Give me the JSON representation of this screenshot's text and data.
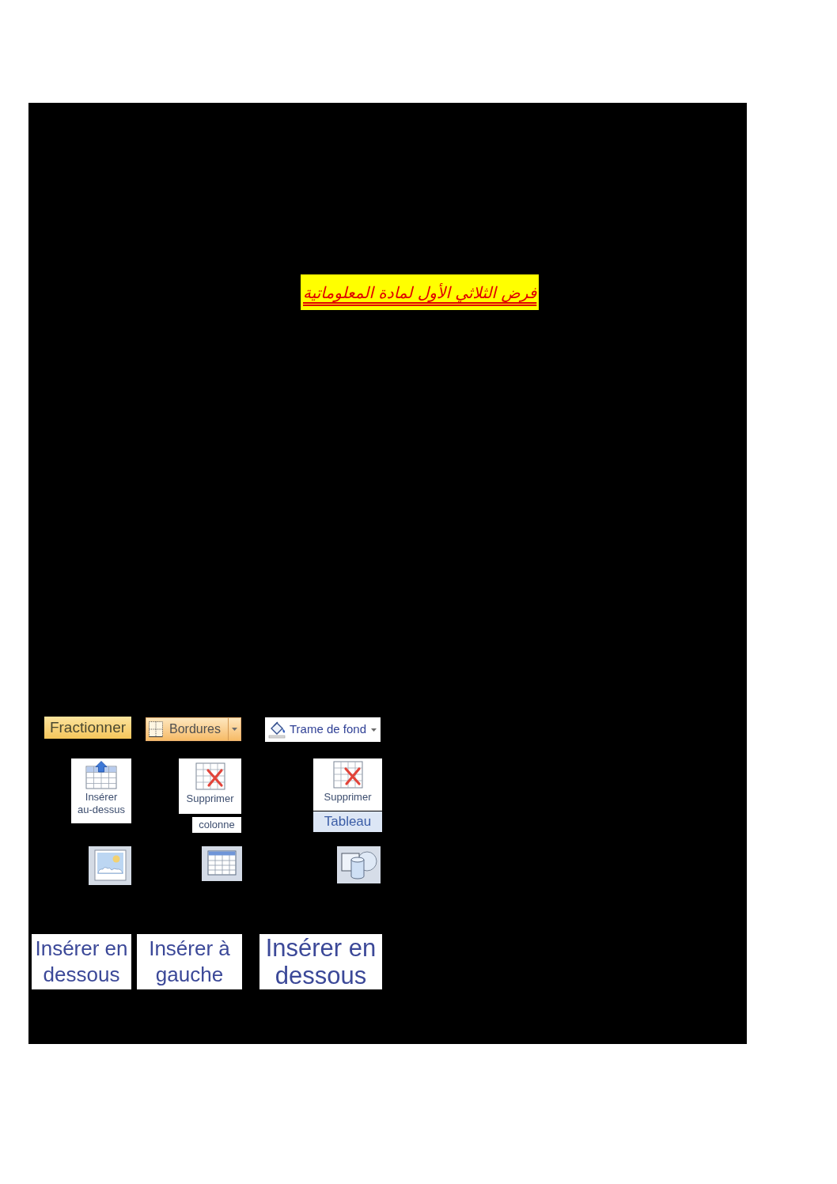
{
  "document": {
    "title": "فرض الثلاثي الأول لمادة المعلوماتية"
  },
  "toolbar_buttons": [
    {
      "kind": "highlighted",
      "label": "Fractionner"
    },
    {
      "kind": "split_dropdown",
      "label": "Bordures"
    },
    {
      "kind": "dropdown",
      "label": "Trame de fond"
    }
  ],
  "large_buttons": [
    {
      "kind": "insert",
      "label": "Insérer au-dessus"
    },
    {
      "kind": "delete",
      "label": "Supprimer",
      "caption": {
        "text": "colonne",
        "highlighted": false
      }
    },
    {
      "kind": "delete",
      "label": "Supprimer",
      "caption": {
        "text": "Tableau",
        "highlighted": true
      }
    }
  ],
  "large_labels": [
    {
      "label": "Insérer en dessous"
    },
    {
      "label": "Insérer à gauche"
    },
    {
      "label": "Insérer en dessous"
    }
  ]
}
